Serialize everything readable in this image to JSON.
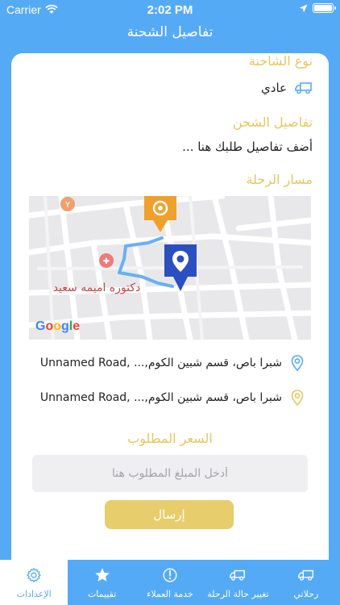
{
  "status_bar": {
    "carrier": "Carrier",
    "time": "2:02 PM"
  },
  "header": {
    "title": "تفاصيل الشحنة"
  },
  "truck_type": {
    "title": "نوع الشاحنة",
    "value": "عادي"
  },
  "shipment_details": {
    "title": "تفاصيل الشحن",
    "value": "أضف تفاصيل طلبك هنا ..."
  },
  "route": {
    "title": "مسار الرحلة",
    "map_label": "دكتوره اميمه سعيد",
    "map_logo": "Google",
    "from_address": "Unnamed Road, ...,شبرا باص، قسم شبين الكوم",
    "to_address": "Unnamed Road, ...,شبرا باص، قسم شبين الكوم"
  },
  "price": {
    "title": "السعر المطلوب",
    "placeholder": "أدخل المبلغ المطلوب هنا",
    "send_label": "إرسال"
  },
  "tabs": [
    {
      "label": "الإعدادات",
      "icon": "gear-icon",
      "active": true
    },
    {
      "label": "تقييمات",
      "icon": "star-icon",
      "active": false
    },
    {
      "label": "خدمة العملاء",
      "icon": "support-icon",
      "active": false
    },
    {
      "label": "تغيير حالة الرحلة",
      "icon": "truck-icon",
      "active": false
    },
    {
      "label": "رحلاتي",
      "icon": "truck-icon",
      "active": false
    }
  ],
  "colors": {
    "primary": "#55aaf6",
    "accent": "#e7c65d",
    "button": "#e7cd6b"
  }
}
